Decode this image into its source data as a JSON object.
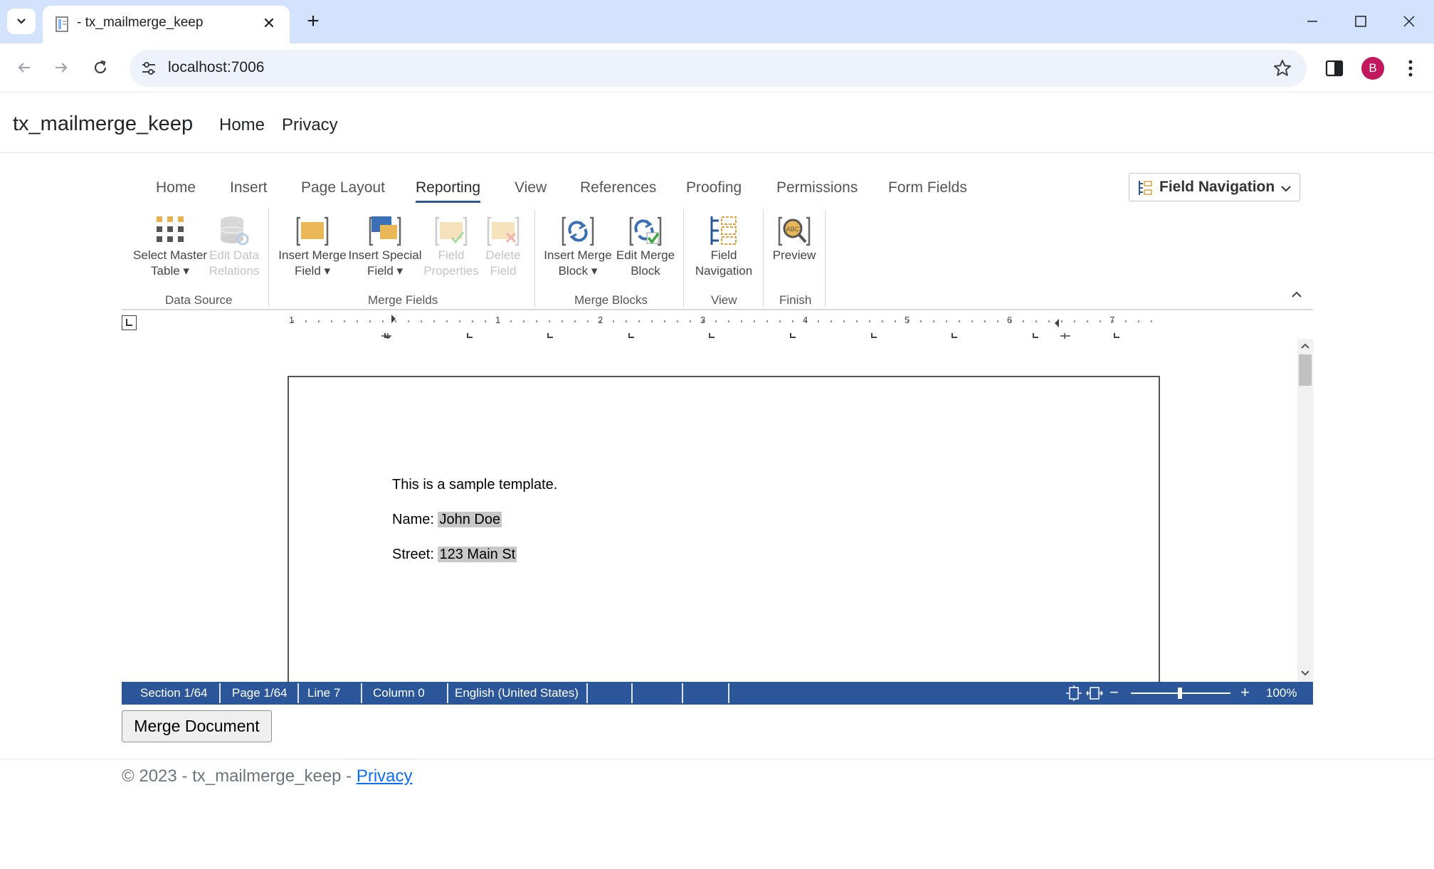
{
  "browser": {
    "tab_title": "- tx_mailmerge_keep",
    "url": "localhost:7006",
    "avatar_letter": "B"
  },
  "site": {
    "brand": "tx_mailmerge_keep",
    "nav": [
      "Home",
      "Privacy"
    ]
  },
  "ribbon": {
    "tabs": [
      "Home",
      "Insert",
      "Page Layout",
      "Reporting",
      "View",
      "References",
      "Proofing",
      "Permissions",
      "Form Fields"
    ],
    "active_tab": "Reporting",
    "field_navigation_dropdown": "Field Navigation",
    "buttons": [
      {
        "label": "Select Master\nTable ▾",
        "enabled": true,
        "icon": "grid-icon"
      },
      {
        "label": "Edit Data\nRelations",
        "enabled": false,
        "icon": "database-icon"
      },
      {
        "label": "Insert Merge\nField ▾",
        "enabled": true,
        "icon": "merge-field-icon"
      },
      {
        "label": "Insert Special\nField ▾",
        "enabled": true,
        "icon": "special-field-icon"
      },
      {
        "label": "Field\nProperties",
        "enabled": false,
        "icon": "field-properties-icon"
      },
      {
        "label": "Delete\nField",
        "enabled": false,
        "icon": "delete-field-icon"
      },
      {
        "label": "Insert Merge\nBlock ▾",
        "enabled": true,
        "icon": "merge-block-icon"
      },
      {
        "label": "Edit Merge\nBlock",
        "enabled": true,
        "icon": "edit-merge-block-icon"
      },
      {
        "label": "Field\nNavigation",
        "enabled": true,
        "icon": "field-navigation-icon"
      },
      {
        "label": "Preview",
        "enabled": true,
        "icon": "preview-icon"
      }
    ],
    "groups": [
      "Data Source",
      "Merge Fields",
      "Merge Blocks",
      "View",
      "Finish"
    ]
  },
  "ruler": {
    "numbers": [
      "1",
      "1",
      "2",
      "3",
      "4",
      "5",
      "6",
      "7"
    ]
  },
  "document": {
    "line1": "This is a sample template.",
    "name_label": "Name: ",
    "name_value": "John Doe",
    "street_label": "Street: ",
    "street_value": "123 Main St"
  },
  "statusbar": {
    "section": "Section 1/64",
    "page": "Page 1/64",
    "line": "Line 7",
    "column": "Column 0",
    "language": "English (United States)",
    "zoom_minus": "−",
    "zoom_plus": "+",
    "zoom": "100%"
  },
  "actions": {
    "merge_button": "Merge Document"
  },
  "footer": {
    "text": "© 2023 - tx_mailmerge_keep - ",
    "link": "Privacy"
  },
  "colors": {
    "accent": "#2b579a",
    "tabstrip": "#d3e3fd",
    "field_highlight": "#c8c8c8"
  }
}
